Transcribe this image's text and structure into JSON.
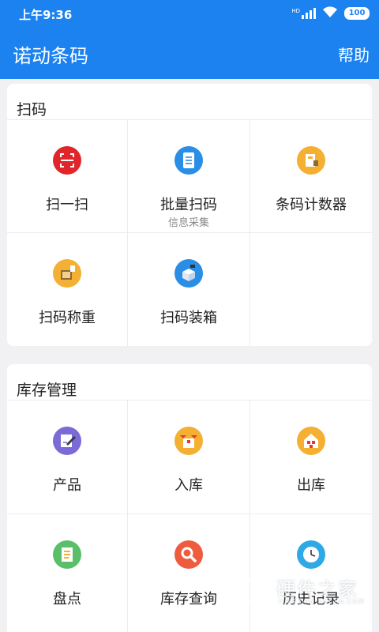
{
  "status_bar": {
    "time": "上午9:36",
    "network": "HD",
    "battery": "100"
  },
  "app_bar": {
    "title": "诺动条码",
    "help": "帮助"
  },
  "sections": [
    {
      "title": "扫码",
      "items": [
        {
          "label": "扫一扫",
          "icon": "scan-icon",
          "color": "#e0262b"
        },
        {
          "label": "批量扫码",
          "sublabel": "信息采集",
          "icon": "batch-list-icon",
          "color": "#2a8ee6"
        },
        {
          "label": "条码计数器",
          "icon": "counter-icon",
          "color": "#f3b032"
        },
        {
          "label": "扫码称重",
          "icon": "scale-icon",
          "color": "#f3b032"
        },
        {
          "label": "扫码装箱",
          "icon": "boxing-icon",
          "color": "#2a8ee6"
        }
      ]
    },
    {
      "title": "库存管理",
      "items": [
        {
          "label": "产品",
          "icon": "product-edit-icon",
          "color": "#7a6bd6"
        },
        {
          "label": "入库",
          "icon": "inbound-box-icon",
          "color": "#f3b032"
        },
        {
          "label": "出库",
          "icon": "outbound-warehouse-icon",
          "color": "#f3b032"
        },
        {
          "label": "盘点",
          "icon": "inventory-check-icon",
          "color": "#5bbf6a"
        },
        {
          "label": "库存查询",
          "icon": "search-icon",
          "color": "#ef5b3e"
        },
        {
          "label": "历史记录",
          "icon": "clock-icon",
          "color": "#2fa8e6"
        }
      ]
    }
  ],
  "watermark": {
    "text": "硬件之家",
    "subtext": "YING JIAN ZHI JIA.COM"
  }
}
